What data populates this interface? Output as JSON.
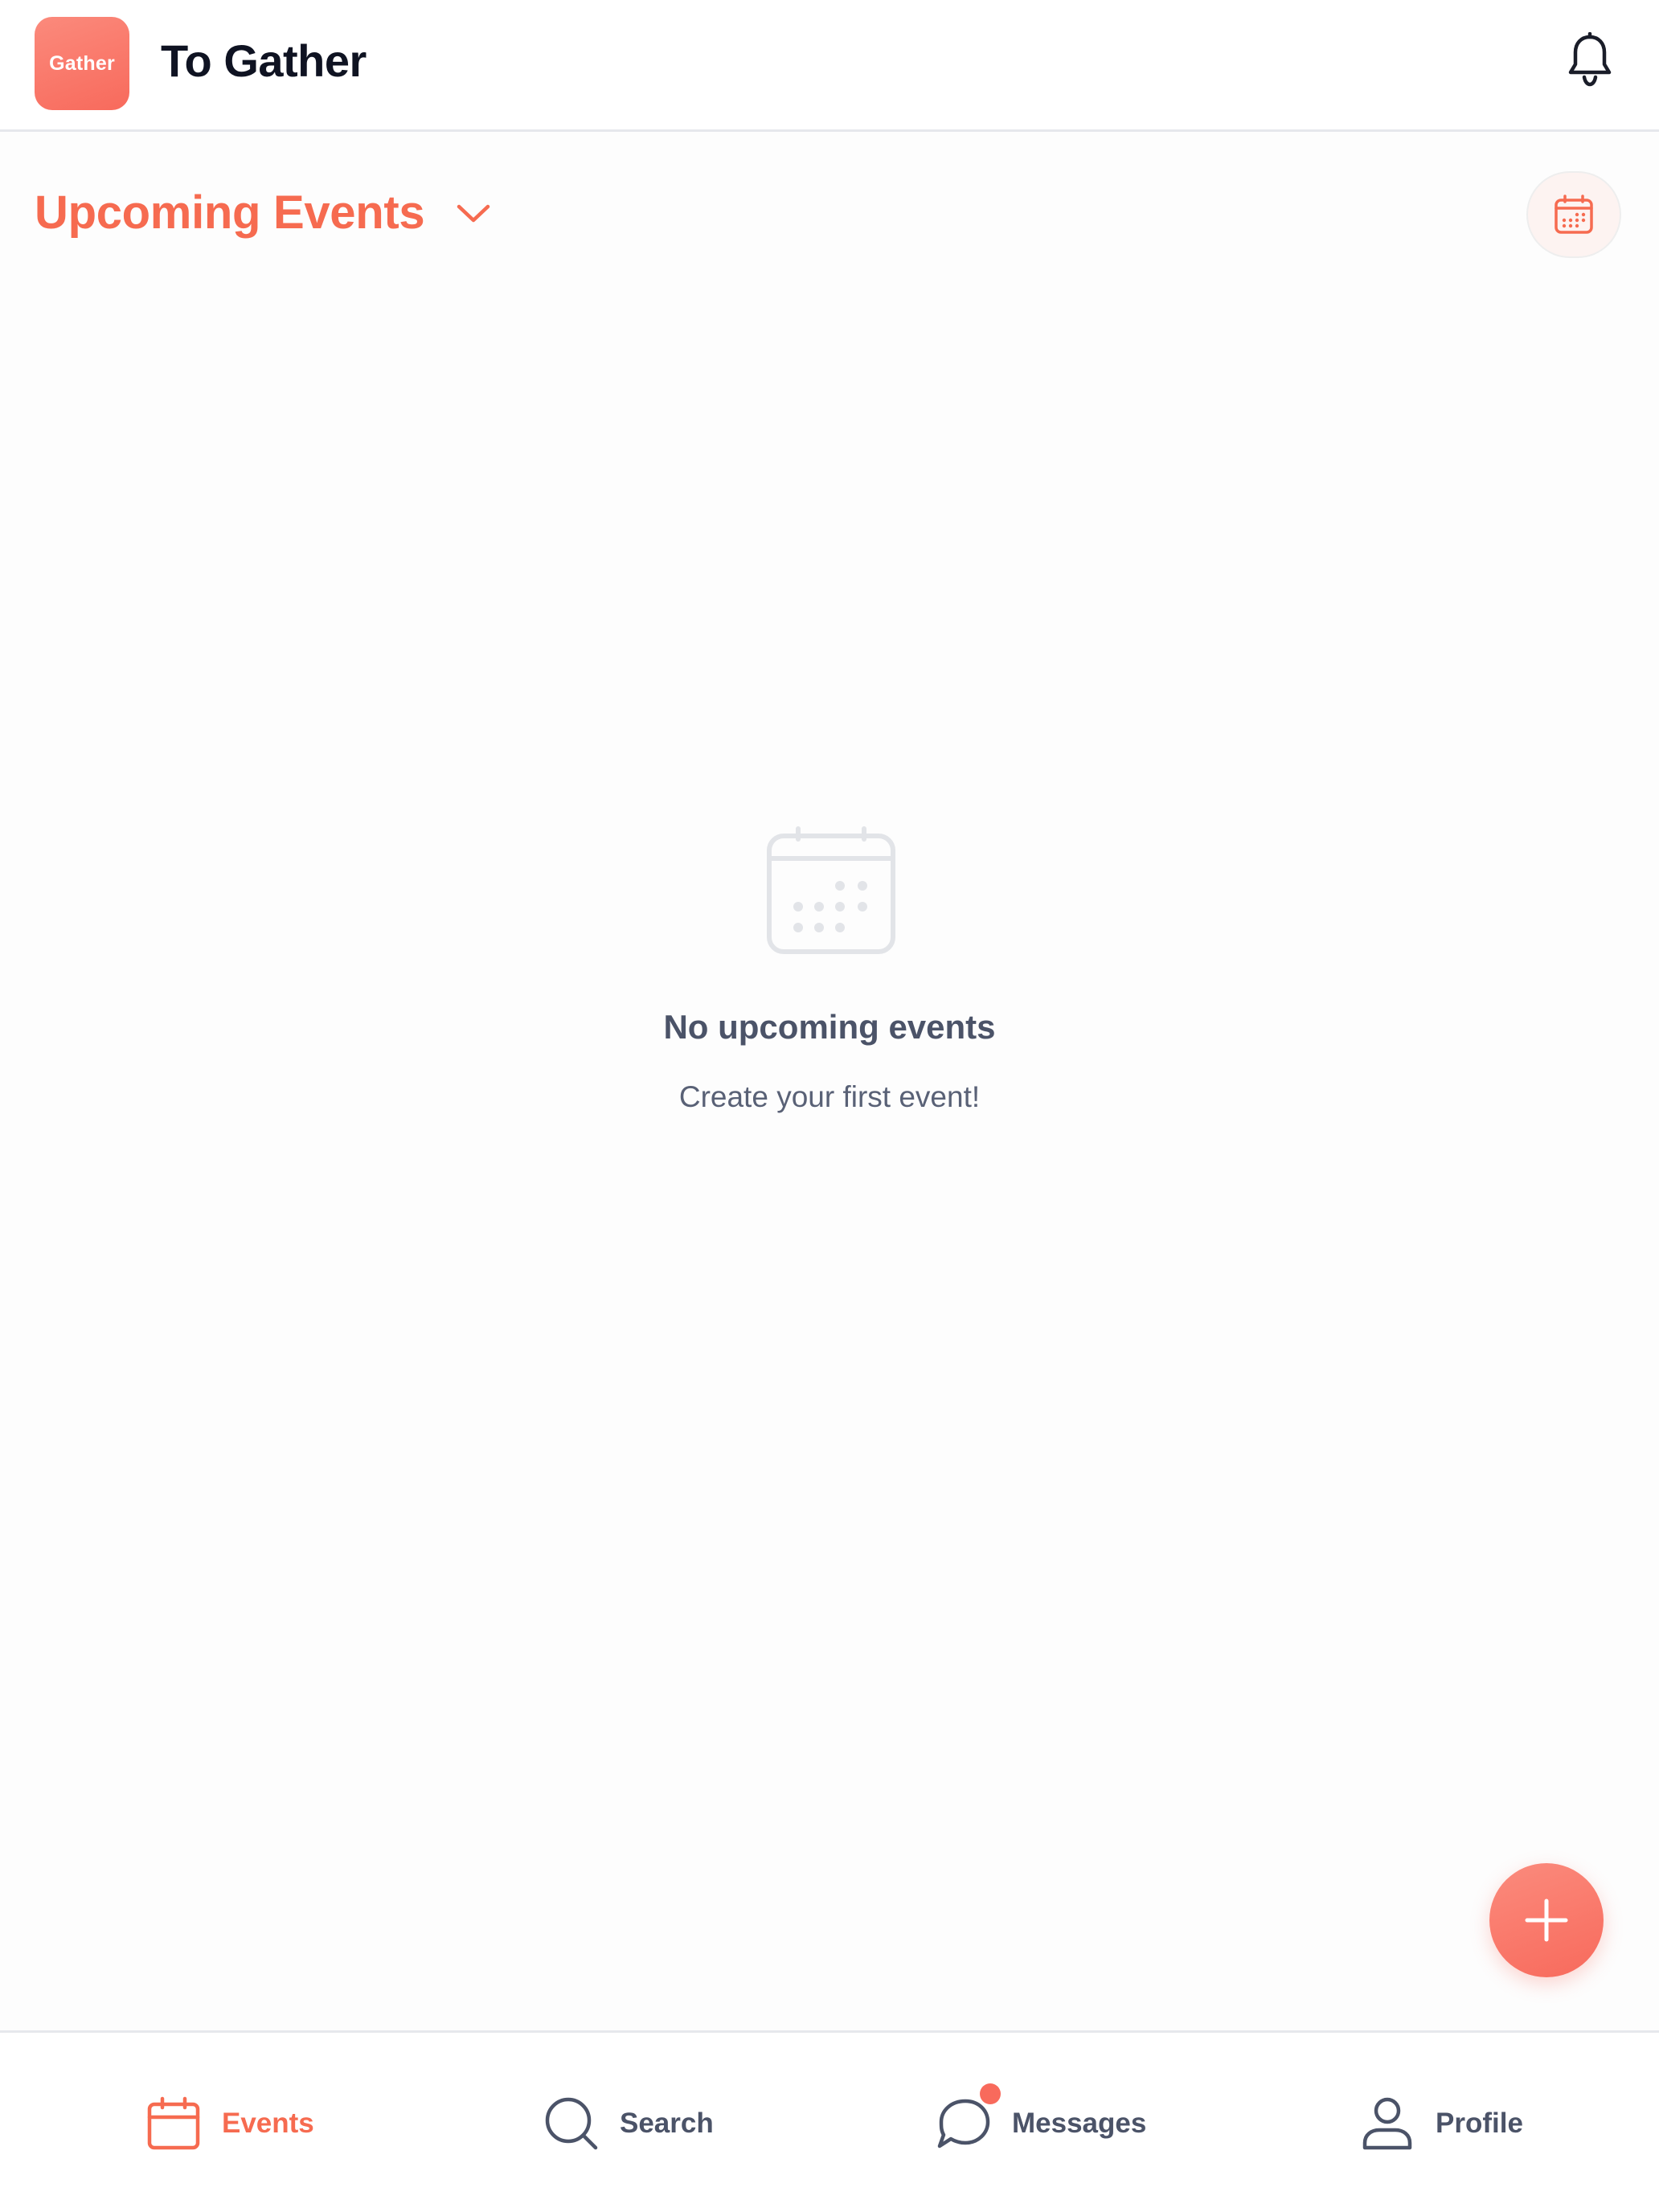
{
  "header": {
    "logo_text": "Gather",
    "title": "To Gather",
    "notification_icon": "bell-icon"
  },
  "section": {
    "title": "Upcoming Events",
    "dropdown_icon": "chevron-down-icon",
    "calendar_button_icon": "calendar-icon"
  },
  "empty_state": {
    "icon": "calendar-icon",
    "title": "No upcoming events",
    "subtitle": "Create your first event!"
  },
  "fab": {
    "icon": "plus-icon"
  },
  "bottom_nav": {
    "items": [
      {
        "label": "Events",
        "icon": "calendar-icon",
        "active": true
      },
      {
        "label": "Search",
        "icon": "search-icon",
        "active": false
      },
      {
        "label": "Messages",
        "icon": "chat-bubble-icon",
        "active": false,
        "has_unread_dot": true
      },
      {
        "label": "Profile",
        "icon": "user-icon",
        "active": false
      }
    ]
  },
  "colors": {
    "accent": "#f66b50",
    "brand_gradient_start": "#fb8a7c",
    "brand_gradient_end": "#f86a5c",
    "text_dark": "#0f1322",
    "text_muted": "#4b5368",
    "divider": "#e6e8ec"
  }
}
